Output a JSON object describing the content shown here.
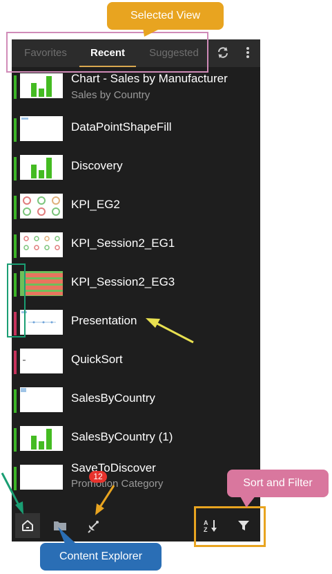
{
  "tabs": [
    {
      "label": "Favorites",
      "active": false
    },
    {
      "label": "Recent",
      "active": true
    },
    {
      "label": "Suggested",
      "active": false
    }
  ],
  "tab_icons": [
    "refresh-icon",
    "more-vertical-icon"
  ],
  "items": [
    {
      "title": "Chart - Sales by Manufacturer",
      "subtitle": "Sales by Country",
      "thumb": "bar-chart",
      "status_color": "#3cb527"
    },
    {
      "title": "DataPointShapeFill",
      "thumb": "blank-doc",
      "status_color": "#3cb527"
    },
    {
      "title": "Discovery",
      "thumb": "bar-chart",
      "status_color": "#3cb527"
    },
    {
      "title": "KPI_EG2",
      "thumb": "gauges",
      "status_color": "#3cb527"
    },
    {
      "title": "KPI_Session2_EG1",
      "thumb": "gauges-small",
      "status_color": "#3cb527"
    },
    {
      "title": "KPI_Session2_EG3",
      "thumb": "stripes",
      "status_color": "#3cb527"
    },
    {
      "title": "Presentation",
      "thumb": "line-doc",
      "status_color": "#c8325c"
    },
    {
      "title": "QuickSort",
      "thumb": "small-doc",
      "status_color": "#c8325c"
    },
    {
      "title": "SalesByCountry",
      "thumb": "corner-doc",
      "status_color": "#3cb527"
    },
    {
      "title": "SalesByCountry (1)",
      "thumb": "bar-chart",
      "status_color": "#3cb527"
    },
    {
      "title": "SaveToDiscover",
      "subtitle": "Promotion Category",
      "thumb": "blank-doc",
      "status_color": "#3cb527"
    }
  ],
  "bottom_bar": {
    "left_icons": [
      "home-icon",
      "folder-icon",
      "satellite-icon"
    ],
    "badge_count": "12",
    "right_icons": [
      "sort-az-icon",
      "filter-icon"
    ]
  },
  "annotations": {
    "selected_view": "Selected View",
    "sort_filter": "Sort and Filter",
    "content_explorer": "Content Explorer"
  },
  "colors": {
    "panel_bg": "#1e1e1e",
    "tab_bar_bg": "#2c2c2c",
    "active_underline": "#d9a84f",
    "status_green": "#3cb527",
    "status_red": "#c8325c",
    "badge_red": "#e8332d",
    "callout_orange": "#e8a420",
    "callout_pink": "#d9779e",
    "callout_blue": "#2a6eb5",
    "frame_pink": "#d08bb8",
    "frame_teal": "#1a9e73",
    "frame_orange": "#e8a420"
  }
}
